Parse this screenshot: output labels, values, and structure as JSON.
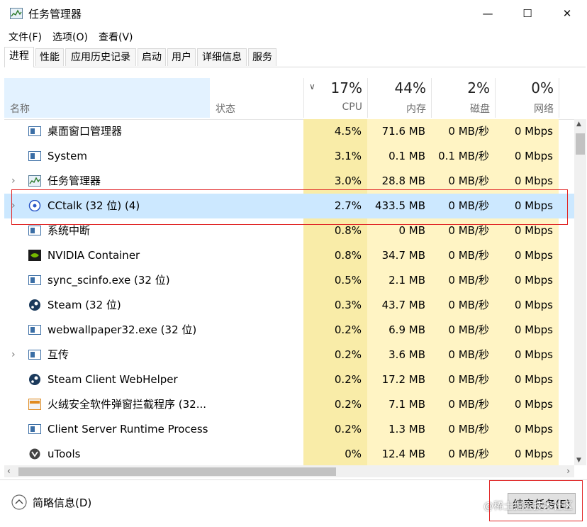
{
  "window": {
    "title": "任务管理器",
    "min": "—",
    "max": "☐",
    "close": "✕"
  },
  "menu": [
    "文件(F)",
    "选项(O)",
    "查看(V)"
  ],
  "tabs": [
    "进程",
    "性能",
    "应用历史记录",
    "启动",
    "用户",
    "详细信息",
    "服务"
  ],
  "header": {
    "name": "名称",
    "status": "状态",
    "cpu_pct": "17%",
    "cpu": "CPU",
    "mem_pct": "44%",
    "mem": "内存",
    "disk_pct": "2%",
    "disk": "磁盘",
    "net_pct": "0%",
    "net": "网络"
  },
  "rows": [
    {
      "name": "桌面窗口管理器",
      "icon": "app-window-icon",
      "expand": "",
      "cpu": "4.5%",
      "mem": "71.6 MB",
      "disk": "0 MB/秒",
      "net": "0 Mbps"
    },
    {
      "name": "System",
      "icon": "app-window-icon",
      "expand": "",
      "cpu": "3.1%",
      "mem": "0.1 MB",
      "disk": "0.1 MB/秒",
      "net": "0 Mbps"
    },
    {
      "name": "任务管理器",
      "icon": "task-manager-icon",
      "expand": "›",
      "cpu": "3.0%",
      "mem": "28.8 MB",
      "disk": "0 MB/秒",
      "net": "0 Mbps"
    },
    {
      "name": "CCtalk (32 位) (4)",
      "icon": "cctalk-icon",
      "expand": "›",
      "cpu": "2.7%",
      "mem": "433.5 MB",
      "disk": "0 MB/秒",
      "net": "0 Mbps"
    },
    {
      "name": "系统中断",
      "icon": "app-window-icon",
      "expand": "",
      "cpu": "0.8%",
      "mem": "0 MB",
      "disk": "0 MB/秒",
      "net": "0 Mbps"
    },
    {
      "name": "NVIDIA Container",
      "icon": "nvidia-icon",
      "expand": "",
      "cpu": "0.8%",
      "mem": "34.7 MB",
      "disk": "0 MB/秒",
      "net": "0 Mbps"
    },
    {
      "name": "sync_scinfo.exe (32 位)",
      "icon": "app-window-icon",
      "expand": "",
      "cpu": "0.5%",
      "mem": "2.1 MB",
      "disk": "0 MB/秒",
      "net": "0 Mbps"
    },
    {
      "name": "Steam (32 位)",
      "icon": "steam-icon",
      "expand": "",
      "cpu": "0.3%",
      "mem": "43.7 MB",
      "disk": "0 MB/秒",
      "net": "0 Mbps"
    },
    {
      "name": "webwallpaper32.exe (32 位)",
      "icon": "app-window-icon",
      "expand": "",
      "cpu": "0.2%",
      "mem": "6.9 MB",
      "disk": "0 MB/秒",
      "net": "0 Mbps"
    },
    {
      "name": "互传",
      "icon": "app-window-icon",
      "expand": "›",
      "cpu": "0.2%",
      "mem": "3.6 MB",
      "disk": "0 MB/秒",
      "net": "0 Mbps"
    },
    {
      "name": "Steam Client WebHelper",
      "icon": "steam-icon",
      "expand": "",
      "cpu": "0.2%",
      "mem": "17.2 MB",
      "disk": "0 MB/秒",
      "net": "0 Mbps"
    },
    {
      "name": "火绒安全软件弹窗拦截程序 (32...",
      "icon": "huorong-icon",
      "expand": "",
      "cpu": "0.2%",
      "mem": "7.1 MB",
      "disk": "0 MB/秒",
      "net": "0 Mbps"
    },
    {
      "name": "Client Server Runtime Process",
      "icon": "app-window-icon",
      "expand": "",
      "cpu": "0.2%",
      "mem": "1.3 MB",
      "disk": "0 MB/秒",
      "net": "0 Mbps"
    },
    {
      "name": "uTools",
      "icon": "utools-icon",
      "expand": "",
      "cpu": "0%",
      "mem": "12.4 MB",
      "disk": "0 MB/秒",
      "net": "0 Mbps"
    }
  ],
  "footer": {
    "summary": "简略信息(D)",
    "end_task": "结束任务(E)"
  },
  "watermark": "@稀土掘金技术社区",
  "colors": {
    "heat": "#fff4c4",
    "heat_strong": "#f9eca8",
    "selected": "#cce8ff",
    "highlight_box": "#e12828"
  }
}
